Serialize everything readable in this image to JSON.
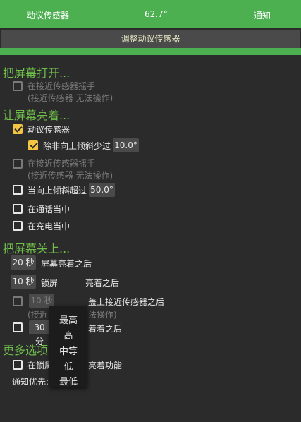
{
  "topbar": {
    "left": "动议传感器",
    "center": "62.7°",
    "right": "通知"
  },
  "adjust_button": "调整动议传感器",
  "sections": {
    "turn_on": "把屏幕打开...",
    "keep_on": "让屏幕亮着...",
    "turn_off": "把屏幕关上...",
    "more": "更多选项"
  },
  "turn_on": {
    "wave_label": "在接近传感器摇手",
    "wave_sub": "(接近传感器 无法操作)"
  },
  "keep_on": {
    "motion_label": "动议传感器",
    "unless_label": "除非向上倾斜少过",
    "unless_value": "10.0°",
    "wave_label": "在接近传感器摇手",
    "wave_sub": "(接近传感器 无法操作)",
    "tilt_label": "当向上倾斜超过",
    "tilt_value": "50.0°",
    "call_label": "在通话当中",
    "charge_label": "在充电当中"
  },
  "turn_off": {
    "screen_value": "20 秒",
    "screen_label": "屏幕亮着之后",
    "lock_value": "10 秒",
    "lock_label_a": "锁屏",
    "lock_label_b": "亮着之后",
    "cover_value": "10 秒",
    "cover_label": "盖上接近传感器之后",
    "cover_sub_a": "(接近",
    "cover_sub_b": "法操作)",
    "bright_value": "30 分",
    "bright_label": "着着之后"
  },
  "more": {
    "lock_label_a": "在锁屏",
    "lock_label_b": "亮着功能",
    "notify_label": "通知优先:"
  },
  "priority_popup": [
    "最高",
    "高",
    "中等",
    "低",
    "最低"
  ],
  "colors": {
    "topbar": "#4caf50",
    "section": "#6fbf4a",
    "checkbox_checked": "#f4c542"
  }
}
